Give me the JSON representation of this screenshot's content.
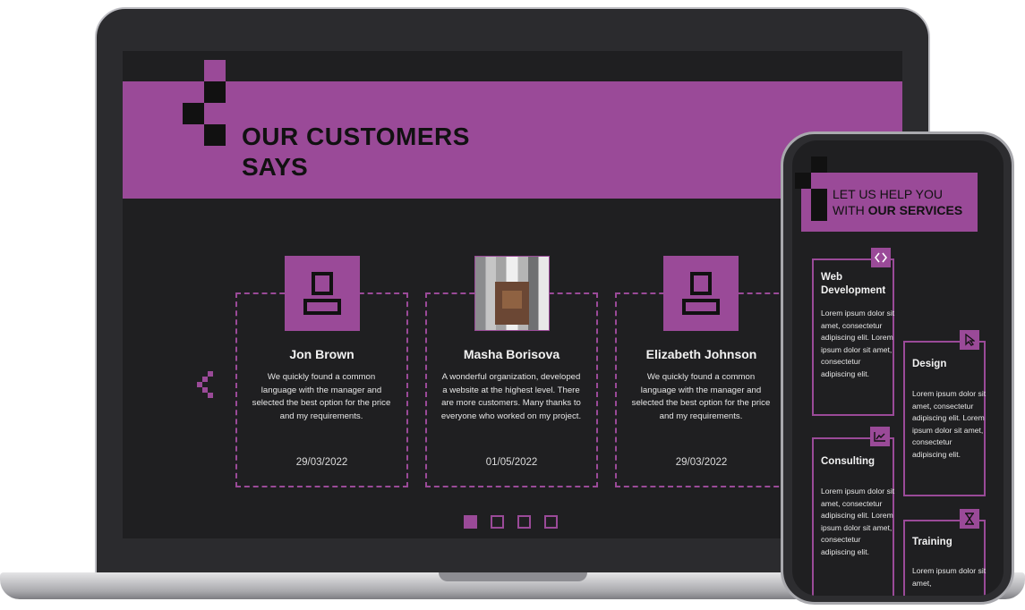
{
  "laptop": {
    "banner": {
      "title": "OUR CUSTOMERS",
      "subtitle": "SAYS"
    },
    "testimonials": [
      {
        "name": "Jon Brown",
        "text": "We quickly found a common language with the manager and selected the best option for the price and my requirements.",
        "date": "29/03/2022",
        "avatar": "user-icon"
      },
      {
        "name": "Masha Borisova",
        "text": "A wonderful organization, developed a website at the highest level. There are more customers. Many thanks to everyone who worked on my project.",
        "date": "01/05/2022",
        "avatar": "photo"
      },
      {
        "name": "Elizabeth Johnson",
        "text": "We quickly found a common language with the manager and selected the best option for the price and my requirements.",
        "date": "29/03/2022",
        "avatar": "user-icon"
      }
    ],
    "carousel": {
      "active_index": 0,
      "pages": 4
    }
  },
  "phone": {
    "banner": {
      "line1": "LET US HELP YOU",
      "line2_prefix": "WITH ",
      "line2_bold": "OUR SERVICES"
    },
    "services": [
      {
        "name": "Web Development",
        "text": "Lorem ipsum dolor sit amet, consectetur adipiscing elit. Lorem ipsum dolor sit amet, consectetur adipiscing elit.",
        "icon": "code-icon"
      },
      {
        "name": "Design",
        "text": "Lorem ipsum dolor sit amet, consectetur adipiscing elit. Lorem ipsum dolor sit amet, consectetur adipiscing elit.",
        "icon": "cursor-icon"
      },
      {
        "name": "Consulting",
        "text": "Lorem ipsum dolor sit amet, consectetur adipiscing elit. Lorem ipsum dolor sit amet, consectetur adipiscing elit.",
        "icon": "chart-icon"
      },
      {
        "name": "Training",
        "text": "Lorem ipsum dolor sit amet,",
        "icon": "hourglass-icon"
      }
    ]
  },
  "colors": {
    "accent": "#9a4a98",
    "background": "#1f1f21",
    "text": "#f2f2f2"
  }
}
